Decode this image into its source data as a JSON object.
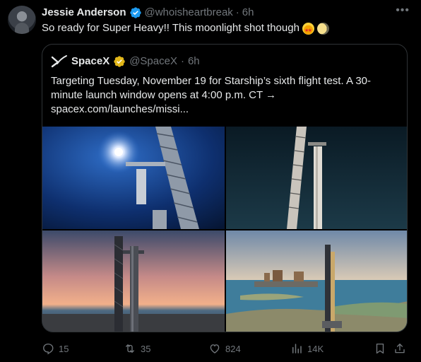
{
  "post": {
    "author_name": "Jessie Anderson",
    "handle": "@whoisheartbreak",
    "separator": "·",
    "time": "6h",
    "text": "So ready for Super Heavy!! This moonlight shot though",
    "emojis": [
      "star-struck-emoji",
      "moon-emoji"
    ]
  },
  "quote": {
    "author_name": "SpaceX",
    "handle": "@SpaceX",
    "separator": "·",
    "time": "6h",
    "text_lines": [
      "Targeting Tuesday, November 19 for Starship’s sixth flight test. A 30-",
      "minute launch window opens at 4:00 p.m. CT →",
      "spacex.com/launches/missi..."
    ],
    "images": [
      "moonlit-tower-photo",
      "night-tower-photo",
      "sunset-tower-photo",
      "aerial-launch-site-photo"
    ]
  },
  "actions": {
    "replies": "15",
    "reposts": "35",
    "likes": "824",
    "views": "14K"
  },
  "colors": {
    "verified_blue": "#1d9bf0",
    "verified_gold": "#e2b719",
    "muted_text": "#71767b",
    "border": "#2f3336"
  }
}
